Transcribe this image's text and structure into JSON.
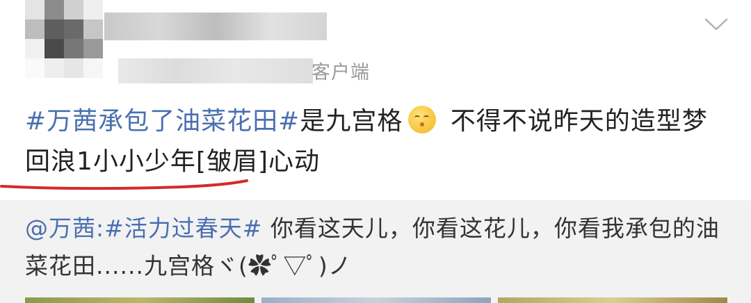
{
  "header": {
    "source_suffix": "客户端",
    "menu_icon": "chevron-down-icon"
  },
  "post": {
    "segments": [
      {
        "type": "hashtag",
        "text": "#万茜承包了油菜花田#"
      },
      {
        "type": "text",
        "text": "是九宫格"
      },
      {
        "type": "emoji",
        "name": "kissing-face-emoji"
      },
      {
        "type": "text",
        "text": " 不得不说昨天的造型梦回浪1小小少年[皱眉]心动"
      }
    ]
  },
  "repost": {
    "mention": "@万茜:",
    "hashtag": "#活力过春天#",
    "text": "  你看这天儿，你看这花儿，你看我承包的油菜花田......九宫格ヾ(✿ﾟ▽ﾟ)ノ"
  },
  "colors": {
    "link": "#4a6fb0",
    "text": "#222222",
    "meta": "#9a9a9a",
    "repost_bg": "#f2f2f2",
    "underline": "#d42a2a"
  }
}
